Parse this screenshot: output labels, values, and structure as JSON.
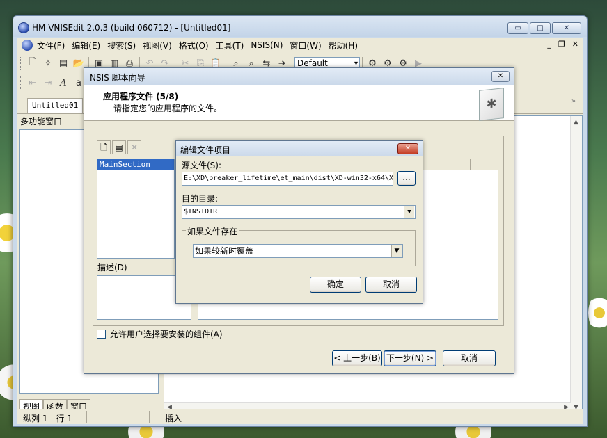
{
  "window": {
    "title": "HM VNISEdit 2.0.3 (build 060712) - [Untitled01]"
  },
  "menu": [
    "文件(F)",
    "编辑(E)",
    "搜索(S)",
    "视图(V)",
    "格式(O)",
    "工具(T)",
    "NSIS(N)",
    "窗口(W)",
    "帮助(H)"
  ],
  "toolbar": {
    "font_combo": "Default"
  },
  "doc_tab": "Untitled01",
  "left_panel": {
    "title": "多功能窗口",
    "tabs": [
      "视图",
      "函数",
      "窗口"
    ]
  },
  "statusbar": {
    "position": "纵列 1 - 行 1",
    "mode": "插入"
  },
  "wizard": {
    "title": "NSIS 脚本向导",
    "heading": "应用程序文件 (5/8)",
    "subheading": "请指定您的应用程序的文件。",
    "sections": [
      "MainSection"
    ],
    "desc_label": "描述(D)",
    "allow_select": "允许用户选择要安装的组件(A)",
    "buttons": {
      "back": "< 上一步(B)",
      "next": "下一步(N) >",
      "cancel": "取消"
    }
  },
  "edit_dialog": {
    "title": "编辑文件项目",
    "source_label": "源文件(S):",
    "source_value": "E:\\XD\\breaker_lifetime\\et_main\\dist\\XD-win32-x64\\X",
    "browse": "...",
    "dest_label": "目的目录:",
    "dest_value": "$INSTDIR",
    "exists_group": "如果文件存在",
    "exists_value": "如果较新时覆盖",
    "ok": "确定",
    "cancel": "取消"
  }
}
